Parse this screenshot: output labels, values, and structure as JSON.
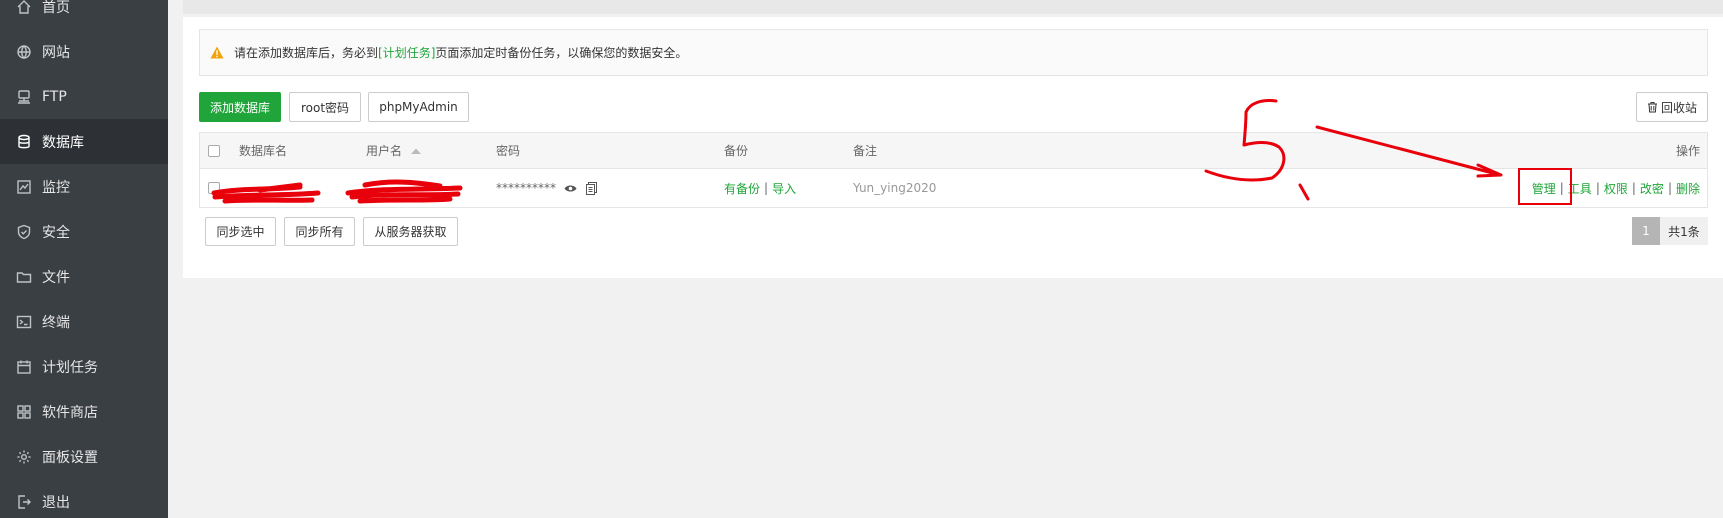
{
  "sidebar": {
    "items": [
      {
        "label": "首页",
        "icon": "home-icon"
      },
      {
        "label": "网站",
        "icon": "globe-icon"
      },
      {
        "label": "FTP",
        "icon": "ftp-icon"
      },
      {
        "label": "数据库",
        "icon": "database-icon",
        "active": true
      },
      {
        "label": "监控",
        "icon": "monitor-icon"
      },
      {
        "label": "安全",
        "icon": "shield-icon"
      },
      {
        "label": "文件",
        "icon": "folder-icon"
      },
      {
        "label": "终端",
        "icon": "terminal-icon"
      },
      {
        "label": "计划任务",
        "icon": "calendar-icon"
      },
      {
        "label": "软件商店",
        "icon": "apps-icon"
      },
      {
        "label": "面板设置",
        "icon": "gear-icon"
      },
      {
        "label": "退出",
        "icon": "logout-icon"
      }
    ]
  },
  "notice": {
    "prefix": "请在添加数据库后，务必到",
    "link": "[计划任务]",
    "suffix": "页面添加定时备份任务，以确保您的数据安全。"
  },
  "toolbar": {
    "add_db": "添加数据库",
    "root_pwd": "root密码",
    "phpmyadmin": "phpMyAdmin",
    "recycle": "回收站"
  },
  "table": {
    "headers": {
      "name": "数据库名",
      "user": "用户名",
      "password": "密码",
      "backup": "备份",
      "note": "备注",
      "actions": "操作"
    },
    "rows": [
      {
        "password_mask": "**********",
        "backup_status": "有备份",
        "import": "导入",
        "note": "Yun_ying2020",
        "actions": [
          "管理",
          "工具",
          "权限",
          "改密",
          "删除"
        ]
      }
    ]
  },
  "footer": {
    "sync_selected": "同步选中",
    "sync_all": "同步所有",
    "fetch_server": "从服务器获取",
    "page": "1",
    "total": "共1条"
  },
  "colors": {
    "sidebar_bg": "#3a3f44",
    "sidebar_active": "#2d3135",
    "accent_green": "#20a53a",
    "annotation_red": "#e8000b"
  }
}
